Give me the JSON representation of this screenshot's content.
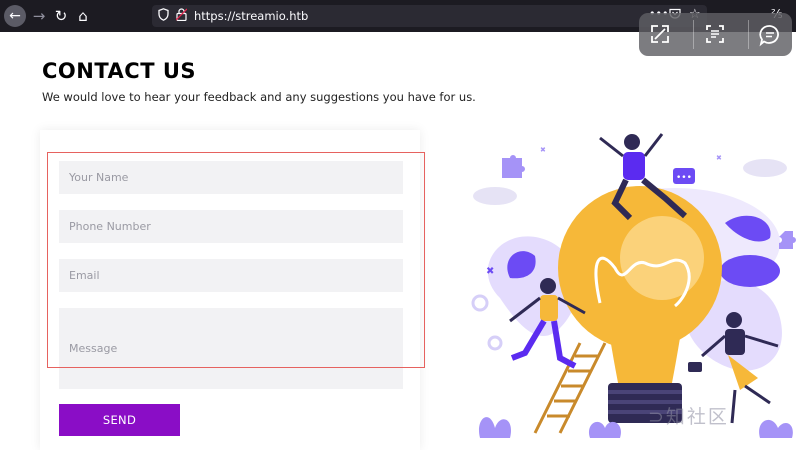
{
  "browser": {
    "url": "https://streamio.htb",
    "back_icon": "arrow-left",
    "forward_icon": "arrow-right",
    "reload_icon": "reload",
    "home_icon": "home",
    "more_glyph": "•••"
  },
  "overlay_toolbar": {
    "buttons": [
      "expand-icon",
      "scan-text-icon",
      "chat-icon"
    ]
  },
  "page": {
    "title": "CONTACT US",
    "subtitle": "We would love to hear your feedback and any suggestions you have for us.",
    "form": {
      "name_placeholder": "Your Name",
      "phone_placeholder": "Phone Number",
      "email_placeholder": "Email",
      "message_placeholder": "Message",
      "send_label": "SEND"
    }
  },
  "colors": {
    "accent": "#8a0dc6",
    "illustration_purple": "#6c4bf4",
    "bulb_yellow": "#f6b839",
    "highlight": "#e6625f"
  },
  "watermark_text": "⊃知社区"
}
